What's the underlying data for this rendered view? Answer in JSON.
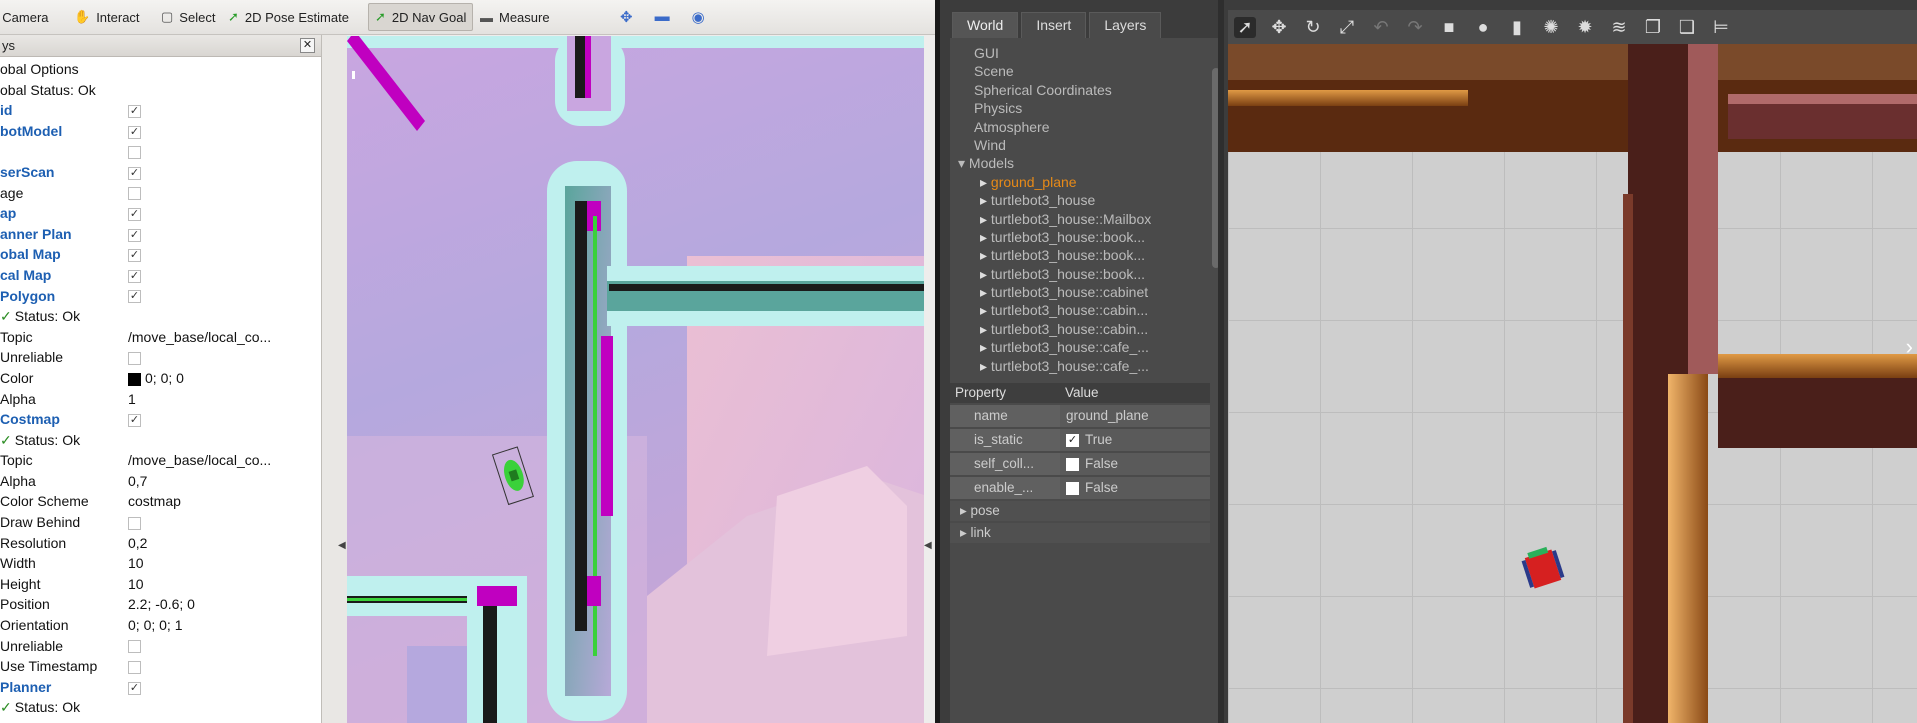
{
  "rviz": {
    "toolbar": [
      {
        "label": "Camera",
        "icon": "camera-icon"
      },
      {
        "label": "Interact",
        "icon": "hand-icon"
      },
      {
        "label": "Select",
        "icon": "select-box-icon"
      },
      {
        "label": "2D Pose Estimate",
        "icon": "pose-arrow-icon"
      },
      {
        "label": "2D Nav Goal",
        "icon": "goal-arrow-icon",
        "active": true
      },
      {
        "label": "Measure",
        "icon": "ruler-icon"
      }
    ],
    "displays_title": "ys",
    "tree": [
      {
        "k": "obal Options",
        "v": ""
      },
      {
        "k": "obal Status: Ok",
        "v": ""
      },
      {
        "k": "id",
        "v": "check",
        "blue": true
      },
      {
        "k": "botModel",
        "v": "check",
        "blue": true
      },
      {
        "k": "",
        "v": "box"
      },
      {
        "k": "serScan",
        "v": "check",
        "blue": true
      },
      {
        "k": "age",
        "v": "box"
      },
      {
        "k": "ap",
        "v": "check",
        "blue": true
      },
      {
        "k": "anner Plan",
        "v": "check",
        "blue": true
      },
      {
        "k": "obal Map",
        "v": "check",
        "blue": true
      },
      {
        "k": "cal Map",
        "v": "check",
        "blue": true
      },
      {
        "k": "Polygon",
        "v": "check",
        "blue": true
      },
      {
        "k": "Status: Ok",
        "v": "",
        "ok": true
      },
      {
        "k": "Topic",
        "v": "/move_base/local_co..."
      },
      {
        "k": "Unreliable",
        "v": "box"
      },
      {
        "k": "Color",
        "v": "0; 0; 0",
        "swatch": true
      },
      {
        "k": "Alpha",
        "v": "1"
      },
      {
        "k": "Costmap",
        "v": "check",
        "blue": true
      },
      {
        "k": "Status: Ok",
        "v": "",
        "ok": true
      },
      {
        "k": "Topic",
        "v": "/move_base/local_co..."
      },
      {
        "k": "Alpha",
        "v": "0,7"
      },
      {
        "k": "Color Scheme",
        "v": "costmap"
      },
      {
        "k": "Draw Behind",
        "v": "box"
      },
      {
        "k": "Resolution",
        "v": "0,2"
      },
      {
        "k": "Width",
        "v": "10"
      },
      {
        "k": "Height",
        "v": "10"
      },
      {
        "k": "Position",
        "v": "2.2; -0.6; 0"
      },
      {
        "k": "Orientation",
        "v": "0; 0; 0; 1"
      },
      {
        "k": "Unreliable",
        "v": "box"
      },
      {
        "k": "Use Timestamp",
        "v": "box"
      },
      {
        "k": "Planner",
        "v": "check",
        "blue": true
      },
      {
        "k": "Status: Ok",
        "v": "",
        "ok": true
      }
    ]
  },
  "gazebo": {
    "tabs": [
      "World",
      "Insert",
      "Layers"
    ],
    "world_items": [
      {
        "label": "GUI",
        "indent": 1
      },
      {
        "label": "Scene",
        "indent": 1
      },
      {
        "label": "Spherical Coordinates",
        "indent": 1
      },
      {
        "label": "Physics",
        "indent": 1
      },
      {
        "label": "Atmosphere",
        "indent": 1
      },
      {
        "label": "Wind",
        "indent": 1
      },
      {
        "label": "Models",
        "indent": 0,
        "open": true
      },
      {
        "label": "ground_plane",
        "indent": 2,
        "selected": true
      },
      {
        "label": "turtlebot3_house",
        "indent": 2
      },
      {
        "label": "turtlebot3_house::Mailbox",
        "indent": 2
      },
      {
        "label": "turtlebot3_house::book...",
        "indent": 2
      },
      {
        "label": "turtlebot3_house::book...",
        "indent": 2
      },
      {
        "label": "turtlebot3_house::book...",
        "indent": 2
      },
      {
        "label": "turtlebot3_house::cabinet",
        "indent": 2
      },
      {
        "label": "turtlebot3_house::cabin...",
        "indent": 2
      },
      {
        "label": "turtlebot3_house::cabin...",
        "indent": 2
      },
      {
        "label": "turtlebot3_house::cafe_...",
        "indent": 2
      },
      {
        "label": "turtlebot3_house::cafe_...",
        "indent": 2
      }
    ],
    "prop_header": {
      "property": "Property",
      "value": "Value"
    },
    "props": [
      {
        "k": "name",
        "v": "ground_plane"
      },
      {
        "k": "is_static",
        "v": "True",
        "check": true
      },
      {
        "k": "self_coll...",
        "v": "False",
        "check": false
      },
      {
        "k": "enable_...",
        "v": "False",
        "check": false
      }
    ],
    "expanders": [
      "pose",
      "link"
    ],
    "tools": [
      "select-arrow-icon",
      "translate-icon",
      "rotate-icon",
      "scale-icon",
      "undo-icon",
      "redo-icon",
      "box-shape-icon",
      "sphere-shape-icon",
      "cylinder-shape-icon",
      "point-light-icon",
      "spot-light-icon",
      "directional-light-icon",
      "copy-icon",
      "paste-icon",
      "align-icon"
    ]
  }
}
